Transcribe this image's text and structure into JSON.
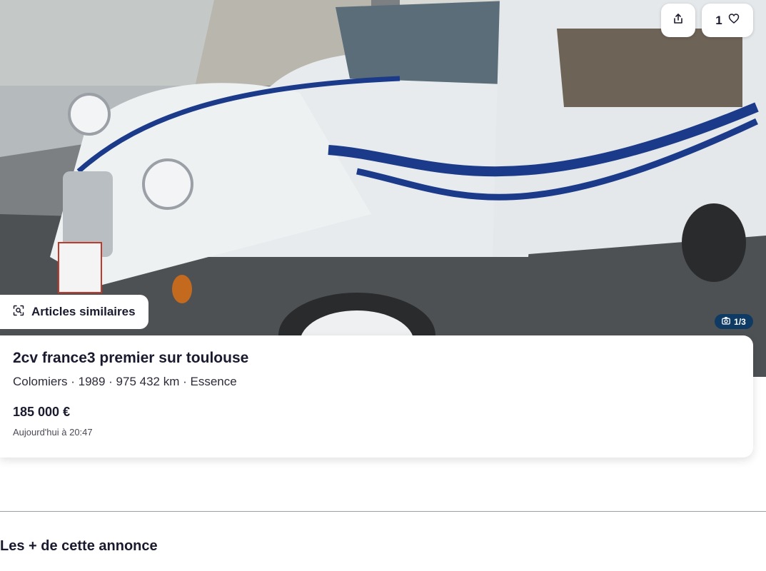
{
  "photo": {
    "alt": "Citroën 2CV blanche à bandes bleues",
    "counter": "1/3",
    "counter_icon": "camera-icon"
  },
  "header": {
    "share_icon": "share-icon",
    "favorites_count": "1",
    "favorite_icon": "heart-icon"
  },
  "similar": {
    "label": "Articles similaires",
    "icon": "visual-search-icon"
  },
  "listing": {
    "title": "2cv france3 premier sur toulouse",
    "meta": "Colomiers · 1989 · 975 432 km · Essence",
    "price": "185 000 €",
    "date": "Aujourd'hui à 20:47"
  },
  "section": {
    "title": "Les + de cette annonce"
  },
  "colors": {
    "badge": "#0f3a63",
    "text": "#1a1a2e"
  }
}
